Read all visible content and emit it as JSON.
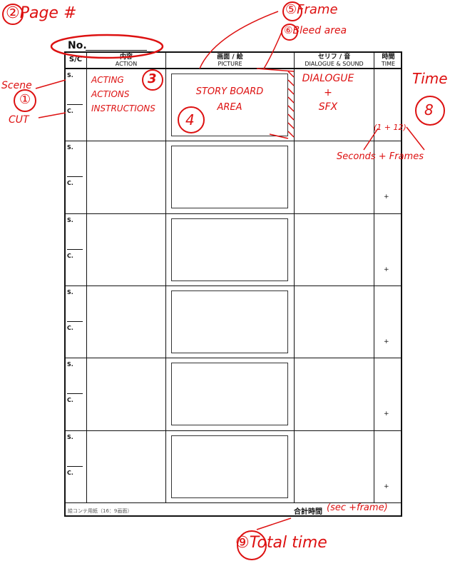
{
  "header": {
    "no_label": "No."
  },
  "columns": {
    "sc": "S/C",
    "action_jp": "内容",
    "action_en": "ACTION",
    "picture_jp": "画面 / 絵",
    "picture_en": "PICTURE",
    "dialogue_jp": "セリフ / 音",
    "dialogue_en": "DIALOGUE & SOUND",
    "time_jp": "時間",
    "time_en": "TIME"
  },
  "row_labels": {
    "scene": "S.",
    "cut": "C.",
    "plus": "+"
  },
  "footer": {
    "left_note": "絵コンテ用紙（16：9画面）",
    "total_label": "合計時間",
    "total_note": "(sec +frame)"
  },
  "annotations": {
    "page_num": "②Page #",
    "frame": "⑤Frame",
    "bleed": "⑥Bleed area",
    "scene": "Scene",
    "scene_num": "①",
    "cut": "CUT",
    "acting": [
      "ACTING",
      "ACTIONS",
      "INSTRUCTIONS"
    ],
    "acting_num": "3",
    "storyboard": [
      "STORY BOARD",
      "AREA"
    ],
    "storyboard_num": "4",
    "dialogue": [
      "DIALOGUE",
      "+",
      "SFX"
    ],
    "time": "Time",
    "time_num": "8",
    "time_example": "(1 + 12)",
    "seconds_frames": "Seconds + Frames",
    "total_time": "⑨Total time"
  },
  "colors": {
    "annotation": "#d11111",
    "ink": "#111111"
  }
}
